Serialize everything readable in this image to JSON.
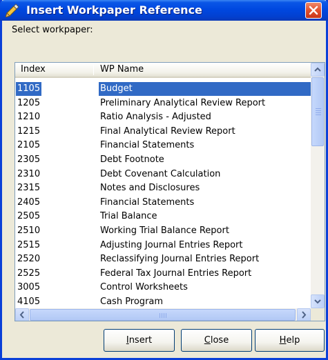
{
  "window": {
    "title": "Insert Workpaper Reference",
    "icon": "workpaper-icon",
    "close_icon": "close-icon"
  },
  "prompt": "Select workpaper:",
  "list": {
    "columns": [
      "Index",
      "WP Name"
    ],
    "selected_index": 0,
    "rows": [
      {
        "index": "1105",
        "name": "Budget"
      },
      {
        "index": "1205",
        "name": "Preliminary Analytical Review Report"
      },
      {
        "index": "1210",
        "name": "Ratio Analysis - Adjusted"
      },
      {
        "index": "1215",
        "name": "Final Analytical Review Report"
      },
      {
        "index": "2105",
        "name": "Financial Statements"
      },
      {
        "index": "2305",
        "name": "Debt Footnote"
      },
      {
        "index": "2310",
        "name": "Debt Covenant Calculation"
      },
      {
        "index": "2315",
        "name": "Notes and Disclosures"
      },
      {
        "index": "2405",
        "name": "Financial Statements"
      },
      {
        "index": "2505",
        "name": "Trial Balance"
      },
      {
        "index": "2510",
        "name": "Working Trial Balance Report"
      },
      {
        "index": "2515",
        "name": "Adjusting Journal Entries Report"
      },
      {
        "index": "2520",
        "name": "Reclassifying Journal Entries Report"
      },
      {
        "index": "2525",
        "name": "Federal Tax Journal Entries Report"
      },
      {
        "index": "3005",
        "name": "Control Worksheets"
      },
      {
        "index": "4105",
        "name": "Cash Program"
      }
    ]
  },
  "buttons": {
    "insert": {
      "accel": "I",
      "rest": "nsert"
    },
    "close": {
      "accel": "C",
      "rest": "lose"
    },
    "help": {
      "accel": "H",
      "rest": "elp"
    }
  },
  "colors": {
    "title_bar": "#0048e0",
    "selection": "#316ac5",
    "dialog_bg": "#ece9d8"
  }
}
